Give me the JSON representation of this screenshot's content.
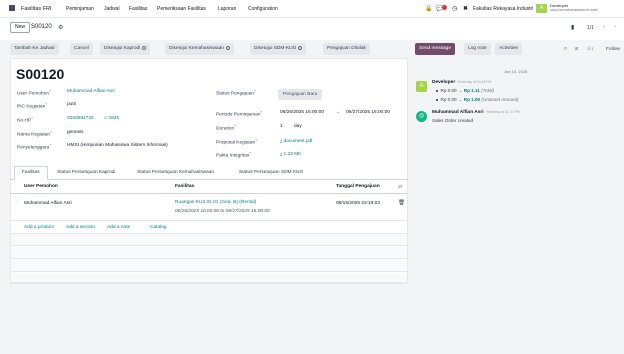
{
  "topbar": {
    "brand": "Fasilitas FRI",
    "menu": [
      "Peminjaman",
      "Jadwal",
      "Fasilitas",
      "Pemeriksaan Fasilitas",
      "Laporan",
      "Configuration"
    ],
    "company": "Fakultas Rekayasa Industri",
    "company_initial": "A",
    "user_name": "Developer",
    "user_db": "odoo-kemahasiswaan-fri-beta"
  },
  "breadcrumb": {
    "new_label": "New",
    "record_name": "S00120",
    "pager": "1/1"
  },
  "actions": {
    "tambah": "Tambah Ke Jadwal",
    "cancel": "Cancel",
    "kaprodi": "Disetujui Kaprodi",
    "kemahasiswaan": "Disetujui Kemahasiswaan",
    "sdm": "Disetujui SDM-KUG",
    "ditolak": "Pengajuan Ditolak"
  },
  "form": {
    "title": "S00120",
    "user_pemohon_label": "User Pemohon",
    "user_pemohon": "Muhammad Alfian Asri",
    "pic_label": "PIC Kegiatan",
    "pic": "putri",
    "nohp_label": "No.HP",
    "nohp": "0283984732",
    "sms": "SMS",
    "nama_label": "Nama Kegiatan",
    "nama": "genesis",
    "penyelenggara_label": "Penyelenggara",
    "penyelenggara": "HMSI (Himpunan Mahasiswa Sistem Informasi)",
    "status_label": "Status Pengajuan",
    "status": "Pengajuan Baru",
    "periode_label": "Periode Peminjaman",
    "periode_start": "06/26/2025 16:00:00",
    "periode_end": "06/27/2025 16:00:00",
    "durasi_label": "Duration",
    "durasi_num": "1",
    "durasi_unit": "day",
    "proposal_label": "Proposal Kegiatan",
    "proposal": "document.pdf",
    "pakta_label": "Pakta Integritas",
    "pakta": "1.23 Mb"
  },
  "tabs": [
    "Fasilitas",
    "Status Persetujuan Kaprodi",
    "Status Persetujuan Kemahasiswaan",
    "Status Persetujuan SDM KUG"
  ],
  "table": {
    "headers": [
      "User Pemohon",
      "Fasilitas",
      "Tanggal Pengajuan"
    ],
    "rows": [
      {
        "user": "Muhammad Alfian Asri",
        "fasilitas": "Ruangan KU2.01.01 (Ged. B) (Rental)",
        "periode": "06/26/2025 16:00:00 to 06/27/2025 16:00:00",
        "tanggal": "06/15/2025 23:18:03"
      }
    ],
    "add_links": [
      "Add a product",
      "Add a section",
      "Add a note",
      "Catalog"
    ]
  },
  "chatter": {
    "send": "Send message",
    "log": "Log note",
    "activities": "Activities",
    "follow": "Follow",
    "followers": "1",
    "date_sep": "Jun 15, 2025",
    "messages": [
      {
        "initial": "A",
        "author": "Developer",
        "time": "Yesterday at 10:18 PM",
        "tracking": [
          {
            "old": "Rp 0.00",
            "new": "Rp 1.11",
            "field": "(Total)"
          },
          {
            "old": "Rp 0.00",
            "new": "Rp 1.00",
            "field": "(Untaxed Amount)"
          }
        ]
      },
      {
        "author": "Muhammad Alfian Asri",
        "time": "Yesterday at 11:47 PM",
        "body": "Sales Order created"
      }
    ]
  },
  "colors": {
    "primary": "#714b67",
    "link": "#017e84",
    "badge_red": "#dc3545",
    "company_badge": "#a3d44a"
  }
}
